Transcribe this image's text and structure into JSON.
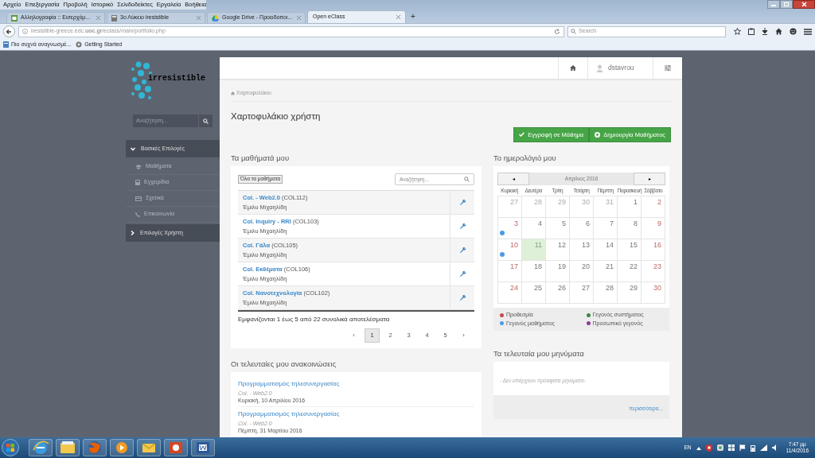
{
  "browser": {
    "menu": [
      "Αρχείο",
      "Επεξεργασία",
      "Προβολή",
      "Ιστορικό",
      "Σελιδοδείκτες",
      "Εργαλεία",
      "Βοήθεια"
    ],
    "tabs": [
      {
        "title": "Αλληλογραφία :: Εισερχόμ...",
        "selected": false
      },
      {
        "title": "3ο Λύκειο iresistible",
        "selected": false
      },
      {
        "title": "Google Drive - Προειδοποι...",
        "selected": false
      },
      {
        "title": "Open eClass",
        "selected": true
      }
    ],
    "new_tab": "+",
    "address": "iresistible-greece.edc.**uoc.gr**/eclass/main/portfolio.php",
    "search_placeholder": "Search",
    "bookmarks": [
      "Πιο συχνά αναγνωσμέ...",
      "Getting Started"
    ]
  },
  "sidebar": {
    "logo": "irresistible",
    "search_placeholder": "Αναζήτηση...",
    "sections": [
      {
        "label": "Βασικές Επιλογές",
        "expanded": true,
        "children": [
          {
            "label": "Μαθήματα"
          },
          {
            "label": "Εγχειρίδια"
          },
          {
            "label": "Σχετικά"
          },
          {
            "label": "Επικοινωνία"
          }
        ]
      },
      {
        "label": "Επιλογές Χρήστη",
        "expanded": false
      }
    ]
  },
  "topbar": {
    "user": "dstavrou"
  },
  "breadcrumb": "Χαρτοφυλάκιο",
  "title": "Χαρτοφυλάκιο χρήστη",
  "actions": [
    "Εγγραφή σε Μάθημα",
    "Δημιουργία Μαθήματος"
  ],
  "courses": {
    "heading": "Τα μαθήματά μου",
    "all_button": "Όλα τα μαθήματα",
    "search_placeholder": "Αναζήτηση...",
    "rows": [
      {
        "title": "Col. - Web2.0",
        "code": "(COL112)",
        "teacher": "Έμιλυ Μιχαηλίδη"
      },
      {
        "title": "Col. Inquiry - RRI",
        "code": "(COL103)",
        "teacher": "Έμιλυ Μιχαηλίδη"
      },
      {
        "title": "Col. Γάλα",
        "code": "(COL105)",
        "teacher": "Έμιλυ Μιχαηλίδη"
      },
      {
        "title": "Col. Εκθέματα",
        "code": "(COL106)",
        "teacher": "Έμιλυ Μιχαηλίδη"
      },
      {
        "title": "Col. Νανοτεχνολογία",
        "code": "(COL102)",
        "teacher": "Έμιλυ Μιχαηλίδη"
      }
    ],
    "summary": "Εμφανίζονται 1 έως 5 από 22 συνολικά αποτελέσματα",
    "pages": [
      {
        "label": "‹",
        "selected": false
      },
      {
        "label": "1",
        "selected": true
      },
      {
        "label": "2",
        "selected": false
      },
      {
        "label": "3",
        "selected": false
      },
      {
        "label": "4",
        "selected": false
      },
      {
        "label": "5",
        "selected": false
      },
      {
        "label": "›",
        "selected": false
      }
    ]
  },
  "announcements": {
    "heading": "Οι τελευταίες μου ανακοινώσεις",
    "items": [
      {
        "title": "Προγραμματισμός τηλεσυνεργασίας",
        "course": "Col. - Web2.0",
        "date": "Κυριακή, 10 Απριλίου 2016"
      },
      {
        "title": "Προγραμματισμός τηλεσυνεργασίας",
        "course": "Col. - Web2.0",
        "date": "Πέμπτη, 31 Μαρτίου 2016"
      }
    ]
  },
  "calendar": {
    "heading": "Το ημερολόγιό μου",
    "month": "Απρίλιος 2016",
    "prev": "◂",
    "next": "▸",
    "weekdays": [
      "Κυριακή",
      "Δευτέρα",
      "Τρίτη",
      "Τετάρτη",
      "Πέμπτη",
      "Παρασκευή",
      "Σάββατο"
    ],
    "weeks": [
      [
        {
          "day": "27",
          "muted": true,
          "today": false
        },
        {
          "day": "28",
          "muted": true,
          "today": false
        },
        {
          "day": "29",
          "muted": true,
          "today": false
        },
        {
          "day": "30",
          "muted": true,
          "today": false
        },
        {
          "day": "31",
          "muted": true,
          "today": false
        },
        {
          "day": "1",
          "muted": false,
          "today": false
        },
        {
          "day": "2",
          "muted": false,
          "today": false
        }
      ],
      [
        {
          "day": "3",
          "muted": false,
          "today": false,
          "color": "#4a9be8"
        },
        {
          "day": "4",
          "muted": false,
          "today": false
        },
        {
          "day": "5",
          "muted": false,
          "today": false
        },
        {
          "day": "6",
          "muted": false,
          "today": false
        },
        {
          "day": "7",
          "muted": false,
          "today": false
        },
        {
          "day": "8",
          "muted": false,
          "today": false
        },
        {
          "day": "9",
          "muted": false,
          "today": false
        }
      ],
      [
        {
          "day": "10",
          "muted": false,
          "today": false,
          "color": "#4a9be8"
        },
        {
          "day": "11",
          "muted": false,
          "today": true
        },
        {
          "day": "12",
          "muted": false,
          "today": false
        },
        {
          "day": "13",
          "muted": false,
          "today": false
        },
        {
          "day": "14",
          "muted": false,
          "today": false
        },
        {
          "day": "15",
          "muted": false,
          "today": false
        },
        {
          "day": "16",
          "muted": false,
          "today": false
        }
      ],
      [
        {
          "day": "17",
          "muted": false,
          "today": false
        },
        {
          "day": "18",
          "muted": false,
          "today": false
        },
        {
          "day": "19",
          "muted": false,
          "today": false
        },
        {
          "day": "20",
          "muted": false,
          "today": false
        },
        {
          "day": "21",
          "muted": false,
          "today": false
        },
        {
          "day": "22",
          "muted": false,
          "today": false
        },
        {
          "day": "23",
          "muted": false,
          "today": false
        }
      ],
      [
        {
          "day": "24",
          "muted": false,
          "today": false
        },
        {
          "day": "25",
          "muted": false,
          "today": false
        },
        {
          "day": "26",
          "muted": false,
          "today": false
        },
        {
          "day": "27",
          "muted": false,
          "today": false
        },
        {
          "day": "28",
          "muted": false,
          "today": false
        },
        {
          "day": "29",
          "muted": false,
          "today": false
        },
        {
          "day": "30",
          "muted": false,
          "today": false
        }
      ]
    ],
    "legend": [
      {
        "label": "Προθεσμία",
        "color": "#c9494b"
      },
      {
        "label": "Γεγονός συστήματος",
        "color": "#3b8a3e"
      },
      {
        "label": "Γεγονός μαθήματος",
        "color": "#4a9be8"
      },
      {
        "label": "Προσωπικό γεγονός",
        "color": "#8e3b94"
      }
    ]
  },
  "messages": {
    "heading": "Τα τελευταία μου μηνύματα",
    "empty": "- Δεν υπάρχουν πρόσφατα μηνύματα-",
    "more": "περισσότερα..."
  },
  "taskbar": {
    "language": "EN",
    "time": "7:47 μμ",
    "date": "11/4/2016"
  }
}
